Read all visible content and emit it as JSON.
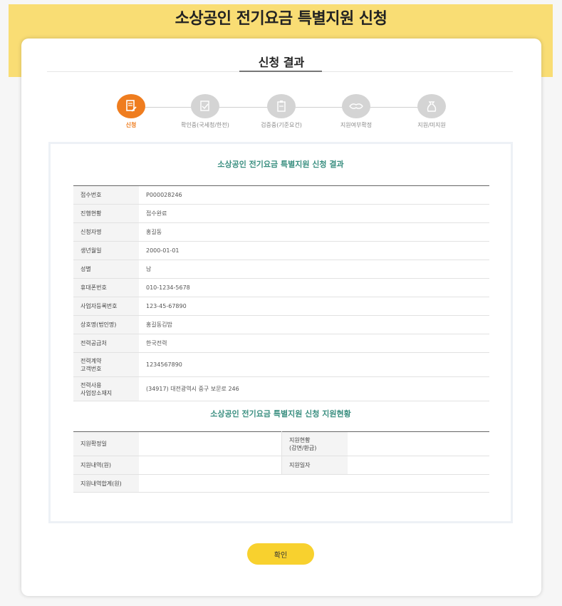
{
  "header": {
    "title": "소상공인 전기요금 특별지원 신청"
  },
  "result": {
    "section_title": "신청 결과"
  },
  "steps": [
    {
      "label": "신청",
      "icon": "document-pen-icon",
      "active": true
    },
    {
      "label": "확인중(국세청/한전)",
      "icon": "document-check-icon",
      "active": false
    },
    {
      "label": "검증중(기준요건)",
      "icon": "clipboard-icon",
      "active": false
    },
    {
      "label": "지원여부확정",
      "icon": "handshake-icon",
      "active": false
    },
    {
      "label": "지원/미지원",
      "icon": "money-bag-icon",
      "active": false
    }
  ],
  "applicant": {
    "title": "소상공인 전기요금 특별지원 신청 결과",
    "rows": [
      {
        "label": "접수번호",
        "value": "P000028246"
      },
      {
        "label": "진행현황",
        "value": "접수완료"
      },
      {
        "label": "신청자명",
        "value": "홍길동"
      },
      {
        "label": "생년월일",
        "value": "2000-01-01"
      },
      {
        "label": "성별",
        "value": "남"
      },
      {
        "label": "휴대폰번호",
        "value": "010-1234-5678"
      },
      {
        "label": "사업자등록번호",
        "value": "123-45-67890"
      },
      {
        "label": "상호명(법인명)",
        "value": "홍길동김밥"
      },
      {
        "label": "전력공급처",
        "value": "한국전력"
      },
      {
        "label": "전력계약\n고객번호",
        "value": "1234567890"
      },
      {
        "label": "전력사용\n사업장소재지",
        "value": "(34917) 대전광역시 중구 보문로 246"
      }
    ]
  },
  "support": {
    "title": "소상공인 전기요금 특별지원 신청 지원현황",
    "confirm_date_label": "지원확정일",
    "confirm_date_value": "",
    "status_label": "지원현황\n(감면/환급)",
    "status_value": "",
    "detail_label": "지원내역(원)",
    "detail_value": "",
    "date_label": "지원일자",
    "date_value": "",
    "total_label": "지원내역합계(원)",
    "total_value": ""
  },
  "actions": {
    "confirm_label": "확인"
  },
  "colors": {
    "accent": "#f9dd74",
    "active_step": "#ef7d1f",
    "button": "#f8d12e",
    "section_text": "#3a8f80"
  }
}
